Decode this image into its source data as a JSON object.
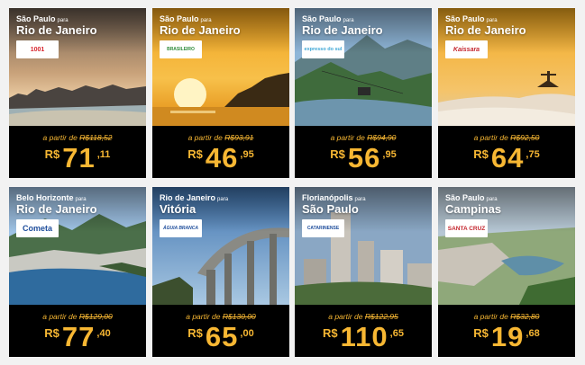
{
  "cards": [
    {
      "origin": "São Paulo",
      "para": "para",
      "destination": "Rio de Janeiro",
      "company": "1001",
      "company_color": "#d8262e",
      "from_label": "a partir de",
      "old_price": "R$118,52",
      "currency": "R$",
      "price_int": "71",
      "price_dec": ",11"
    },
    {
      "origin": "São Paulo",
      "para": "para",
      "destination": "Rio de Janeiro",
      "company": "BRASILEIRO",
      "company_color": "#2e8b3a",
      "from_label": "a partir de",
      "old_price": "R$93,91",
      "currency": "R$",
      "price_int": "46",
      "price_dec": ",95"
    },
    {
      "origin": "São Paulo",
      "para": "para",
      "destination": "Rio de Janeiro",
      "company": "expresso do sul",
      "company_color": "#3ea7d6",
      "from_label": "a partir de",
      "old_price": "R$94,90",
      "currency": "R$",
      "price_int": "56",
      "price_dec": ",95"
    },
    {
      "origin": "São Paulo",
      "para": "para",
      "destination": "Rio de Janeiro",
      "company": "Kaissara",
      "company_color": "#c4262e",
      "from_label": "a partir de",
      "old_price": "R$92,50",
      "currency": "R$",
      "price_int": "64",
      "price_dec": ",75"
    },
    {
      "origin": "Belo Horizonte",
      "para": "para",
      "destination": "Rio de Janeiro",
      "company": "Cometa",
      "company_color": "#1f4e9c",
      "from_label": "a partir de",
      "old_price": "R$129,00",
      "currency": "R$",
      "price_int": "77",
      "price_dec": ",40"
    },
    {
      "origin": "Rio de Janeiro",
      "para": "para",
      "destination": "Vitória",
      "company": "ÁGUIA BRANCA",
      "company_color": "#1f4e9c",
      "from_label": "a partir de",
      "old_price": "R$130,00",
      "currency": "R$",
      "price_int": "65",
      "price_dec": ",00"
    },
    {
      "origin": "Florianópolis",
      "para": "para",
      "destination": "São Paulo",
      "company": "CATARINENSE",
      "company_color": "#1f4e9c",
      "from_label": "a partir de",
      "old_price": "R$122,95",
      "currency": "R$",
      "price_int": "110",
      "price_dec": ",65"
    },
    {
      "origin": "São Paulo",
      "para": "para",
      "destination": "Campinas",
      "company": "SANTA CRUZ",
      "company_color": "#c4262e",
      "from_label": "a partir de",
      "old_price": "R$32,80",
      "currency": "R$",
      "price_int": "19",
      "price_dec": ",68"
    }
  ],
  "colors": {
    "accent": "#f7b733",
    "price_box": "#000000"
  }
}
